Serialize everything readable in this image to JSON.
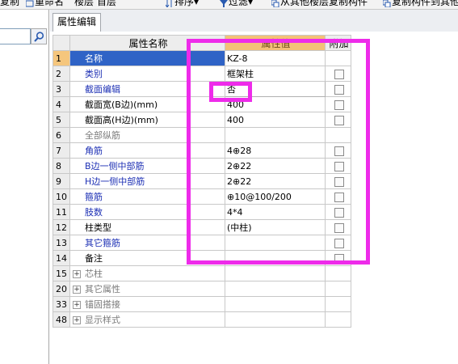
{
  "toolbar": {
    "items": [
      "复制",
      "重命名",
      "楼层",
      "首层",
      "排序",
      "过滤",
      "从其他楼层复制构件",
      "复制构件到其他"
    ]
  },
  "tab": {
    "label": "属性编辑"
  },
  "grid": {
    "headers": {
      "name": "属性名称",
      "value": "属性值",
      "add": "附加"
    },
    "rows": [
      {
        "num": "1",
        "name": "名称",
        "value": "KZ-8",
        "style": "sel"
      },
      {
        "num": "2",
        "name": "类别",
        "value": "框架柱",
        "style": "blue"
      },
      {
        "num": "3",
        "name": "截面编辑",
        "value": "否",
        "style": "blue"
      },
      {
        "num": "4",
        "name": "截面宽(B边)(mm)",
        "value": "400",
        "style": "plain"
      },
      {
        "num": "5",
        "name": "截面高(H边)(mm)",
        "value": "400",
        "style": "plain"
      },
      {
        "num": "6",
        "name": "全部纵筋",
        "value": "",
        "style": "gray"
      },
      {
        "num": "7",
        "name": "角筋",
        "value": "4⊕28",
        "style": "blue"
      },
      {
        "num": "8",
        "name": "B边一侧中部筋",
        "value": "2⊕22",
        "style": "blue"
      },
      {
        "num": "9",
        "name": "H边一侧中部筋",
        "value": "2⊕22",
        "style": "blue"
      },
      {
        "num": "10",
        "name": "箍筋",
        "value": "⊕10@100/200",
        "style": "blue"
      },
      {
        "num": "11",
        "name": "肢数",
        "value": "4*4",
        "style": "blue"
      },
      {
        "num": "12",
        "name": "柱类型",
        "value": "(中柱)",
        "style": "plain"
      },
      {
        "num": "13",
        "name": "其它箍筋",
        "value": "",
        "style": "blue"
      },
      {
        "num": "14",
        "name": "备注",
        "value": "",
        "style": "plain"
      }
    ],
    "groups": [
      {
        "num": "15",
        "name": "芯柱"
      },
      {
        "num": "20",
        "name": "其它属性"
      },
      {
        "num": "33",
        "name": "锚固搭接"
      },
      {
        "num": "48",
        "name": "显示样式"
      }
    ]
  },
  "colors": {
    "annotation": "#ee2bea",
    "selected_row": "#2f63c6",
    "header_value": "#f3c177"
  }
}
